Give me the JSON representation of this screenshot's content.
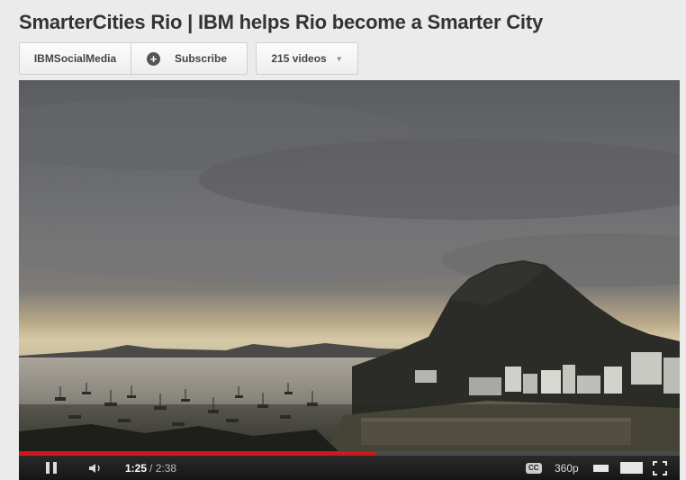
{
  "video": {
    "title": "SmarterCities Rio | IBM helps Rio become a Smarter City"
  },
  "channel": {
    "name": "IBMSocialMedia",
    "subscribe_label": "Subscribe",
    "videos_label": "215 videos"
  },
  "player": {
    "current_time": "1:25",
    "duration": "/ 2:38",
    "cc_label": "CC",
    "quality": "360p",
    "progress_played_fraction": 0.539,
    "progress_loaded_fraction": 0.539,
    "progress_color": "#cc181e"
  },
  "icons": {
    "subscribe": "plus-circle-icon",
    "videos_menu": "caret-down-icon",
    "pause": "pause-icon",
    "volume": "volume-icon",
    "fullscreen": "fullscreen-icon"
  }
}
